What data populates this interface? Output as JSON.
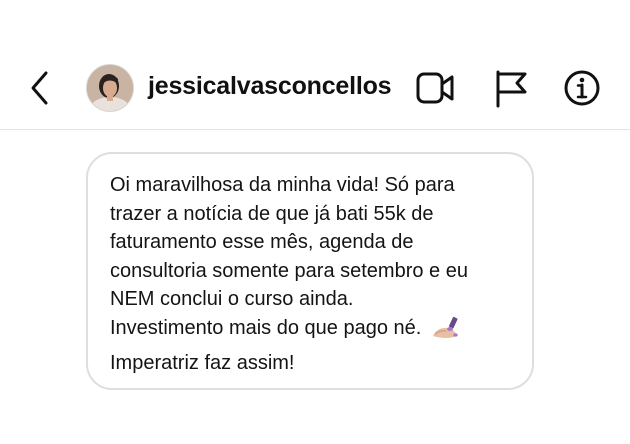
{
  "header": {
    "username": "jessicalvasconcellos",
    "icons": {
      "back": "chevron-left-icon",
      "video": "video-call-icon",
      "report": "flag-icon",
      "info": "info-icon"
    }
  },
  "message": {
    "lines": [
      "Oi maravilhosa da minha vida! Só para",
      "trazer a notícia de que já bati 55k de",
      "faturamento esse mês, agenda de",
      "consultoria somente para setembro e eu",
      "NEM conclui o curso ainda.",
      "Investimento mais do que pago né.",
      "Imperatriz faz assim!"
    ],
    "emoji": "nail-polish-icon"
  },
  "colors": {
    "text": "#111111",
    "bubble_border": "#dedede",
    "divider": "#e4e4e4"
  }
}
